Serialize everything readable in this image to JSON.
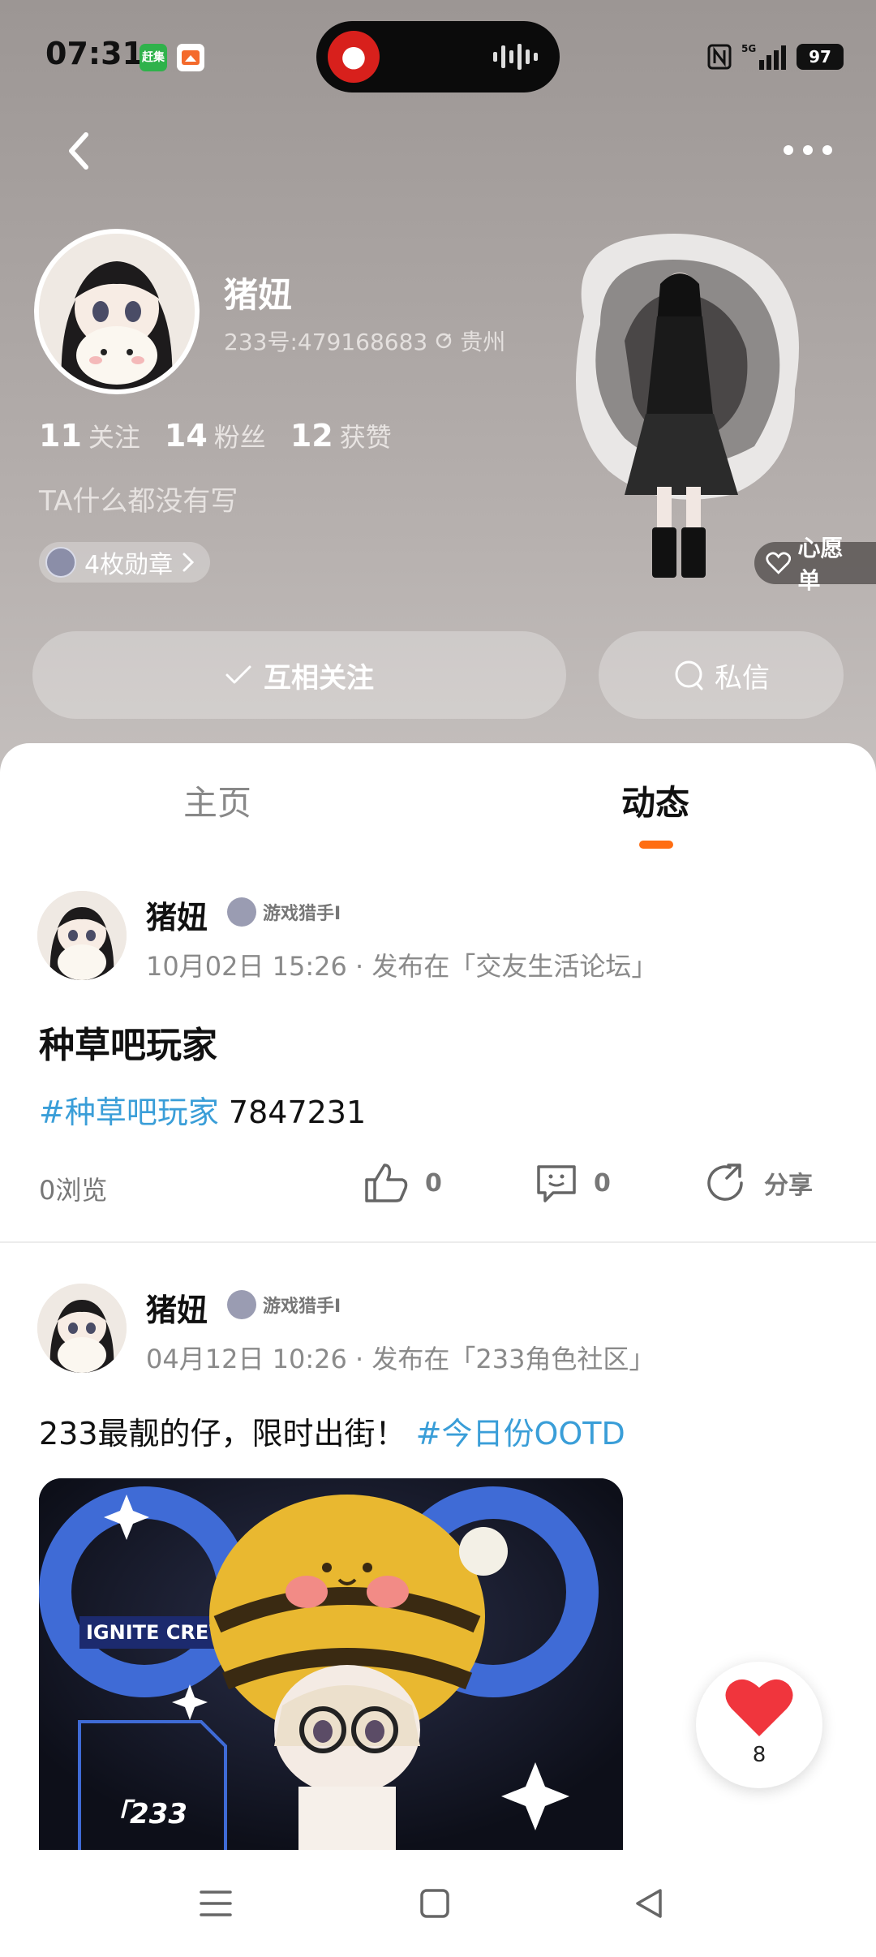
{
  "status_bar": {
    "time": "07:31",
    "app_icon_1": "赶集",
    "battery": "97",
    "network": "5G"
  },
  "profile": {
    "name": "猪妞",
    "id_text": "233号:479168683",
    "location": "贵州",
    "stats": [
      {
        "num": "11",
        "label": "关注"
      },
      {
        "num": "14",
        "label": "粉丝"
      },
      {
        "num": "12",
        "label": "获赞"
      }
    ],
    "bio": "TA什么都没有写",
    "badge": "4枚勋章",
    "wishlist": "心愿单",
    "follow_button": "互相关注",
    "message_button": "私信"
  },
  "tabs": {
    "home": "主页",
    "feed": "动态"
  },
  "posts": [
    {
      "author": "猪妞",
      "tag": "游戏猎手I",
      "meta": "10月02日 15:26 · 发布在「交友生活论坛」",
      "title": "种草吧玩家",
      "hashtag": "#种草吧玩家",
      "body_text": " 7847231",
      "views": "0浏览",
      "likes": "0",
      "comments": "0",
      "share": "分享"
    },
    {
      "author": "猪妞",
      "tag": "游戏猎手I",
      "meta": "04月12日 10:26 · 发布在「233角色社区」",
      "body_text": "233最靓的仔，限时出街！ ",
      "hashtag": "#今日份OOTD",
      "image_text_1": "IGNITE CREW",
      "image_text_2": "「233"
    }
  ],
  "like_fab": {
    "count": "8"
  },
  "colors": {
    "accent": "#ff6d12",
    "hashtag": "#3a9ed8",
    "heart": "#f0353d"
  }
}
